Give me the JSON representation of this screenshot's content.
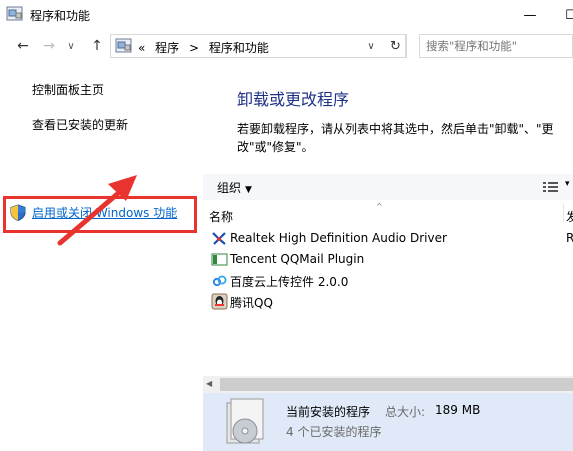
{
  "window": {
    "title": "程序和功能",
    "minimize_glyph": "—",
    "maximize_glyph": "☐"
  },
  "nav": {
    "back_glyph": "←",
    "forward_glyph": "→",
    "recent_glyph": "∨",
    "up_glyph": "↑",
    "crumb_prefix": "«",
    "breadcrumb": [
      "程序",
      "程序和功能"
    ],
    "crumb_separator": ">",
    "dropdown_glyph": "∨",
    "refresh_glyph": "↻",
    "search_placeholder": "搜索\"程序和功能\""
  },
  "left_pane": {
    "home_link": "控制面板主页",
    "updates_link": "查看已安装的更新",
    "features_link": "启用或关闭 Windows 功能"
  },
  "main": {
    "heading": "卸载或更改程序",
    "description": "若要卸载程序，请从列表中将其选中，然后单击\"卸载\"、\"更改\"或\"修复\"。",
    "toolbar": {
      "organize_label": "组织",
      "caret": "▼",
      "view_caret": "▾"
    },
    "columns": {
      "name": "名称",
      "sort_glyph": "^",
      "publisher": "发"
    },
    "programs": [
      {
        "name": "Realtek High Definition Audio Driver",
        "publisher": "R",
        "icon": "realtek-icon"
      },
      {
        "name": "Tencent QQMail Plugin",
        "publisher": "",
        "icon": "qqmail-icon"
      },
      {
        "name": "百度云上传控件 2.0.0",
        "publisher": "",
        "icon": "baidu-cloud-icon"
      },
      {
        "name": "腾讯QQ",
        "publisher": "",
        "icon": "qq-icon"
      }
    ],
    "scroll_left_glyph": "◀",
    "details": {
      "title": "当前安装的程序",
      "size_label": "总大小:",
      "size_value": "189 MB",
      "count": "4 个已安装的程序"
    }
  },
  "colors": {
    "accent_link": "#0066cc",
    "heading": "#1e3287",
    "highlight": "#e8332f",
    "details_bg": "#dfe9f7"
  }
}
